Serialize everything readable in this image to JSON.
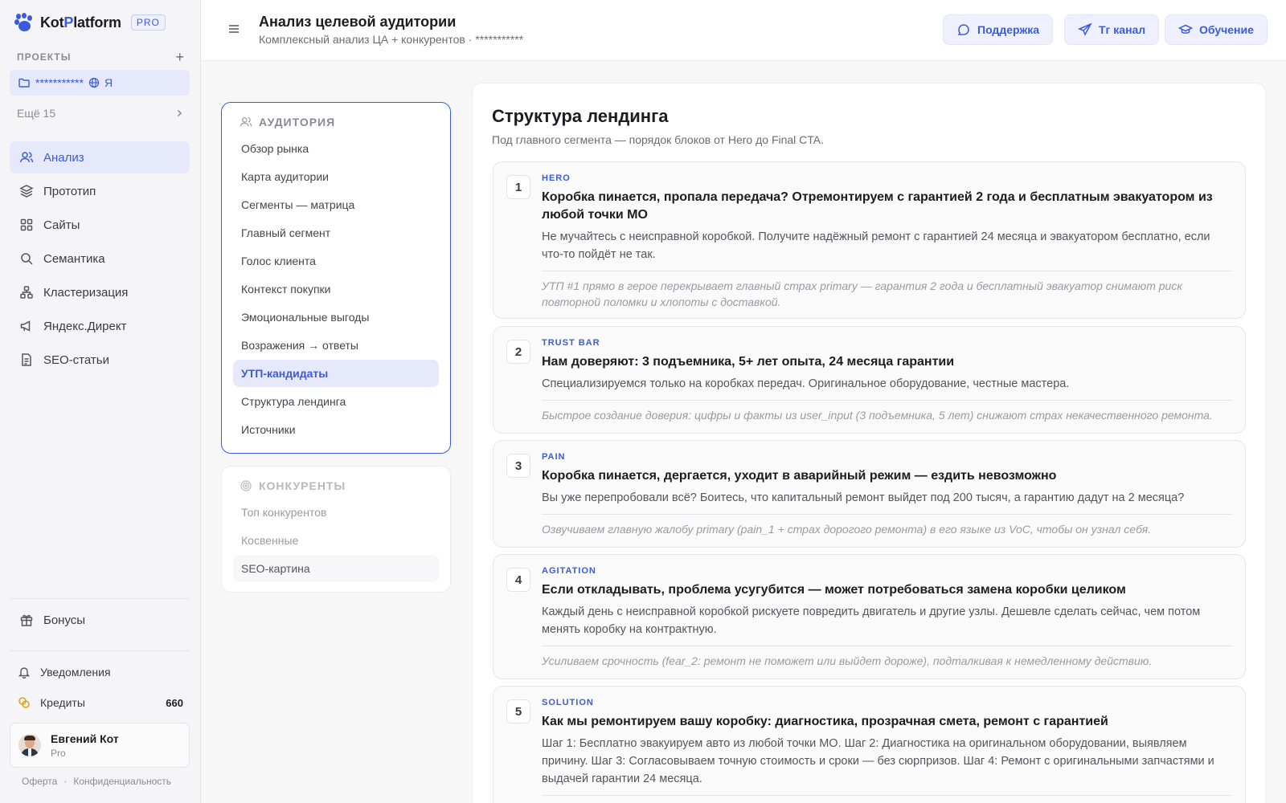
{
  "brand": {
    "name_a": "Kot",
    "name_b": "P",
    "name_c": "latform",
    "badge": "PRO",
    "accent": "#3b5bdb"
  },
  "sidebar": {
    "projects_label": "ПРОЕКТЫ",
    "project": {
      "name": "***********",
      "suffix": "Я"
    },
    "more_label": "Ещё 15",
    "items": [
      {
        "label": "Анализ",
        "icon": "users-icon",
        "active": true
      },
      {
        "label": "Прототип",
        "icon": "layers-icon"
      },
      {
        "label": "Сайты",
        "icon": "grid-icon"
      },
      {
        "label": "Семантика",
        "icon": "search-icon"
      },
      {
        "label": "Кластеризация",
        "icon": "cluster-icon"
      },
      {
        "label": "Яндекс.Директ",
        "icon": "megaphone-icon"
      },
      {
        "label": "SEO-статьи",
        "icon": "document-icon"
      }
    ],
    "bonus_label": "Бонусы",
    "notifications_label": "Уведомления",
    "credits_label": "Кредиты",
    "credits_count": "660",
    "user": {
      "name": "Евгений Кот",
      "plan": "Pro"
    },
    "legal": {
      "offer": "Оферта",
      "dot": "·",
      "privacy": "Конфиденциальность"
    }
  },
  "header": {
    "title": "Анализ целевой аудитории",
    "subtitle": "Комплексный анализ ЦА + конкурентов · ***********",
    "buttons": {
      "support": "Поддержка",
      "tg": "Тг канал",
      "learning": "Обучение"
    }
  },
  "audience_panel": {
    "heading": "АУДИТОРИЯ",
    "items": [
      "Обзор рынка",
      "Карта аудитории",
      "Сегменты — матрица",
      "Главный сегмент",
      "Голос клиента",
      "Контекст покупки",
      "Эмоциональные выгоды",
      "Возражения → ответы",
      "УТП-кандидаты",
      "Структура лендинга",
      "Источники"
    ],
    "active_index": 8
  },
  "competitors_panel": {
    "heading": "КОНКУРЕНТЫ",
    "items": [
      "Топ конкурентов",
      "Косвенные",
      "SEO-картина"
    ]
  },
  "main": {
    "title": "Структура лендинга",
    "subtitle": "Под главного сегмента — порядок блоков от Hero до Final CTA.",
    "blocks": [
      {
        "num": "1",
        "tag": "HERO",
        "heading": "Коробка пинается, пропала передача? Отремонтируем с гарантией 2 года и бесплатным эвакуатором из любой точки МО",
        "text": "Не мучайтесь с неисправной коробкой. Получите надёжный ремонт с гарантией 24 месяца и эвакуатором бесплатно, если что-то пойдёт не так.",
        "note": "УТП #1 прямо в герое перекрывает главный страх primary — гарантия 2 года и бесплатный эвакуатор снимают риск повторной поломки и хлопоты с доставкой."
      },
      {
        "num": "2",
        "tag": "TRUST BAR",
        "heading": "Нам доверяют: 3 подъемника, 5+ лет опыта, 24 месяца гарантии",
        "text": "Специализируемся только на коробках передач. Оригинальное оборудование, честные мастера.",
        "note": "Быстрое создание доверия: цифры и факты из user_input (3 подъемника, 5 лет) снижают страх некачественного ремонта."
      },
      {
        "num": "3",
        "tag": "PAIN",
        "heading": "Коробка пинается, дергается, уходит в аварийный режим — ездить невозможно",
        "text": "Вы уже перепробовали всё? Боитесь, что капитальный ремонт выйдет под 200 тысяч, а гарантию дадут на 2 месяца?",
        "note": "Озвучиваем главную жалобу primary (pain_1 + страх дорогого ремонта) в его языке из VoC, чтобы он узнал себя."
      },
      {
        "num": "4",
        "tag": "AGITATION",
        "heading": "Если откладывать, проблема усугубится — может потребоваться замена коробки целиком",
        "text": "Каждый день с неисправной коробкой рискуете повредить двигатель и другие узлы. Дешевле сделать сейчас, чем потом менять коробку на контрактную.",
        "note": "Усиливаем срочность (fear_2: ремонт не поможет или выйдет дороже), подталкивая к немедленному действию."
      },
      {
        "num": "5",
        "tag": "SOLUTION",
        "heading": "Как мы ремонтируем вашу коробку: диагностика, прозрачная смета, ремонт с гарантией",
        "text": "Шаг 1: Бесплатно эвакуируем авто из любой точки МО. Шаг 2: Диагностика на оригинальном оборудовании, выявляем причину. Шаг 3: Согласовываем точную стоимость и сроки — без сюрпризов. Шаг 4: Ремонт с оригинальными запчастями и выдачей гарантии 24 месяца.",
        "note": ""
      }
    ]
  }
}
